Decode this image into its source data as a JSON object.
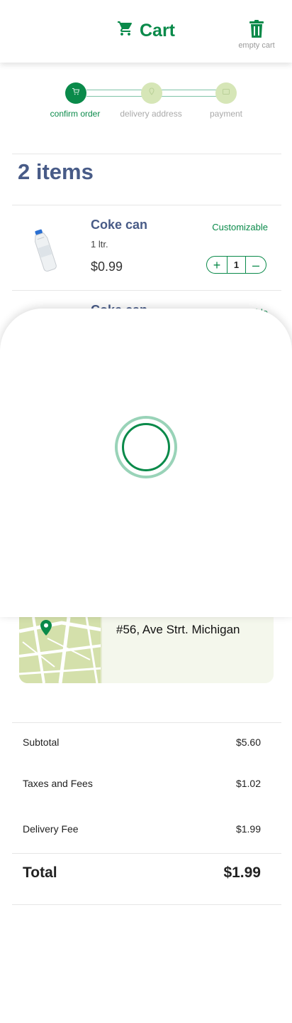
{
  "header": {
    "title": "Cart",
    "empty_cart_label": "empty cart",
    "accent": "#0a8a4a"
  },
  "stepper": {
    "steps": [
      {
        "label": "confirm order",
        "icon": "cart-icon",
        "active": true
      },
      {
        "label": "delivery address",
        "icon": "location-pin-icon",
        "active": false
      },
      {
        "label": "payment",
        "icon": "wallet-icon",
        "active": false
      }
    ]
  },
  "cart": {
    "items_count": "2 items",
    "items": [
      {
        "name": "Coke can",
        "size": "1 ltr.",
        "price": "$0.99",
        "customizable": "Customizable",
        "quantity": "1",
        "plus": "+",
        "minus": "–"
      },
      {
        "name": "Coke can",
        "size": "",
        "price": "",
        "customizable": "Customizable",
        "quantity": "",
        "plus": "",
        "minus": ""
      }
    ]
  },
  "overlay": {
    "state": "loading"
  },
  "address": {
    "text": "#56, Ave Strt. Michigan"
  },
  "totals": {
    "subtotal_label": "Subtotal",
    "subtotal_value": "$5.60",
    "taxes_label": "Taxes and Fees",
    "taxes_value": "$1.02",
    "delivery_label": "Delivery Fee",
    "delivery_value": "$1.99",
    "total_label": "Total",
    "total_value": "$1.99"
  }
}
